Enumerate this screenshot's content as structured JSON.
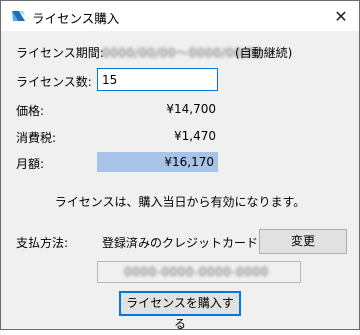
{
  "window": {
    "title": "ライセンス購入",
    "icons": {
      "app": "app-logo-icon",
      "close": "close-icon"
    }
  },
  "license": {
    "period_label": "ライセンス期間:",
    "period_value_obscured": "0000/00/00～0000/00/00",
    "period_suffix": "(自動継続)",
    "quantity_label": "ライセンス数:",
    "quantity_value": "15"
  },
  "pricing": {
    "price_label": "価格:",
    "price_value": "¥14,700",
    "tax_label": "消費税:",
    "tax_value": "¥1,470",
    "monthly_label": "月額:",
    "monthly_value": "¥16,170"
  },
  "notice": "ライセンスは、購入当日から有効になります。",
  "payment": {
    "method_label": "支払方法:",
    "method_value": "登録済みのクレジットカード",
    "change_button": "変更",
    "account_obscured": "0000-0000-0000-0000"
  },
  "purchase_button": "ライセンスを購入する",
  "colors": {
    "accent": "#0078d7",
    "highlight": "#a7c3e8",
    "window_bg": "#f0f0f0"
  }
}
